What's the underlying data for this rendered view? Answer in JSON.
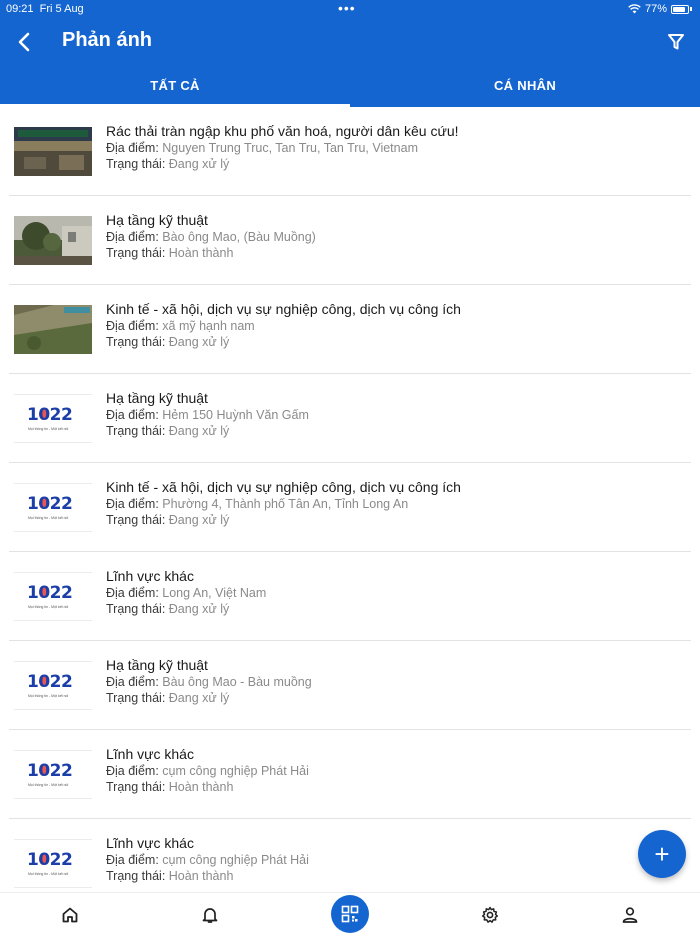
{
  "status_bar": {
    "time": "09:21",
    "date": "Fri 5 Aug",
    "battery": "77%"
  },
  "header": {
    "title": "Phản ánh"
  },
  "tabs": [
    {
      "label": "TẤT CẢ",
      "active": true
    },
    {
      "label": "CÁ NHÂN",
      "active": false
    }
  ],
  "labels": {
    "location": "Địa điểm: ",
    "status": "Trạng thái: "
  },
  "reports": [
    {
      "title": "Rác thải tràn ngập khu phố văn hoá, người dân kêu cứu!",
      "location": "Nguyen Trung Truc, Tan Tru, Tan Tru, Vietnam",
      "status": "Đang xử lý",
      "thumb": "photo-street"
    },
    {
      "title": "Hạ tầng kỹ thuật",
      "location": "Bào ông Mao, (Bàu Muồng)",
      "status": "Hoàn thành",
      "thumb": "photo-house"
    },
    {
      "title": "Kinh tế - xã hội, dịch vụ sự nghiệp công,  dịch vụ công ích",
      "location": "xã mỹ hạnh nam",
      "status": "Đang xử lý",
      "thumb": "photo-ground"
    },
    {
      "title": "Hạ tầng kỹ thuật",
      "location": "Hẻm 150 Huỳnh Văn Gấm",
      "status": "Đang xử lý",
      "thumb": "logo-1022"
    },
    {
      "title": "Kinh tế - xã hội, dịch vụ sự nghiệp công,  dịch vụ công ích",
      "location": "Phường 4, Thành phố Tân An, Tỉnh Long An",
      "status": "Đang xử lý",
      "thumb": "logo-1022"
    },
    {
      "title": "Lĩnh vực khác",
      "location": "Long An, Việt Nam",
      "status": "Đang xử lý",
      "thumb": "logo-1022"
    },
    {
      "title": "Hạ tầng kỹ thuật",
      "location": "Bàu ông Mao - Bàu muồng",
      "status": "Đang xử lý",
      "thumb": "logo-1022"
    },
    {
      "title": "Lĩnh vực khác",
      "location": "cụm công nghiệp Phát Hải",
      "status": "Hoàn thành",
      "thumb": "logo-1022"
    },
    {
      "title": "Lĩnh vực khác",
      "location": "cụm công nghiệp Phát Hải",
      "status": "Hoàn thành",
      "thumb": "logo-1022"
    }
  ],
  "logo": {
    "number": "1022",
    "tagline": "Mọi thông tin - Một kết nối"
  },
  "fab": {
    "icon": "plus-icon",
    "label": "+"
  },
  "bottom_nav": [
    {
      "name": "home",
      "icon": "home-icon"
    },
    {
      "name": "notifications",
      "icon": "bell-icon"
    },
    {
      "name": "qr-scan",
      "icon": "qr-icon"
    },
    {
      "name": "settings",
      "icon": "gear-icon"
    },
    {
      "name": "profile",
      "icon": "user-icon"
    }
  ],
  "colors": {
    "primary": "#1565d0",
    "text": "#1a1a1a",
    "muted": "#8a8a8a",
    "divider": "#e3e3e3"
  }
}
